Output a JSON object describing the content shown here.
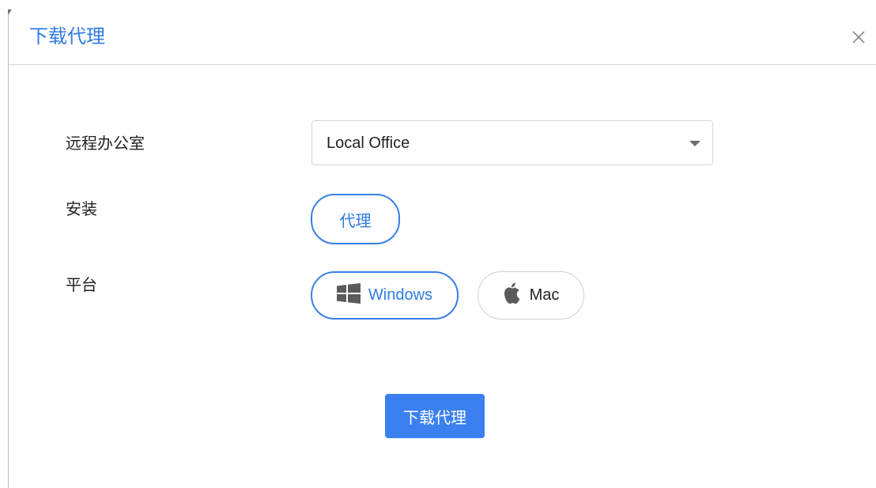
{
  "dialog": {
    "title": "下载代理",
    "close_icon": "close-icon"
  },
  "form": {
    "office_label": "远程办公室",
    "office_value": "Local Office",
    "install_label": "安装",
    "install_option": "代理",
    "platform_label": "平台",
    "platforms": [
      {
        "label": "Windows",
        "icon": "windows-icon",
        "selected": true
      },
      {
        "label": "Mac",
        "icon": "apple-icon",
        "selected": false
      }
    ]
  },
  "actions": {
    "download_label": "下载代理"
  },
  "colors": {
    "accent": "#2f7be5",
    "primary_button": "#3a80f0",
    "border": "#d7d7d7"
  }
}
